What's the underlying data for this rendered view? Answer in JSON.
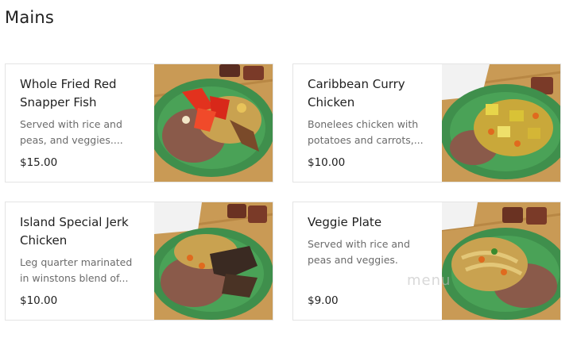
{
  "section": {
    "title": "Mains"
  },
  "items": [
    {
      "name": "Whole Fried Red\nSnapper Fish",
      "description": "Served with rice and\npeas, and veggies....",
      "price": "$15.00",
      "photo_icon": "fried-fish-plate-photo"
    },
    {
      "name": "Caribbean Curry\nChicken",
      "description": "Bonelees chicken with\npotatoes and carrots,...",
      "price": "$10.00",
      "photo_icon": "curry-chicken-plate-photo"
    },
    {
      "name": "Island Special Jerk\nChicken",
      "description": "Leg quarter marinated\nin winstons blend of...",
      "price": "$10.00",
      "photo_icon": "jerk-chicken-plate-photo"
    },
    {
      "name": "Veggie Plate",
      "description": "Served with rice and\npeas and veggies.",
      "price": "$9.00",
      "photo_icon": "veggie-plate-photo"
    }
  ],
  "watermark": {
    "text": "menu"
  },
  "colors": {
    "plate": "#3f8f4c",
    "table": "#c79a58",
    "rice": "#8a5a4a"
  }
}
